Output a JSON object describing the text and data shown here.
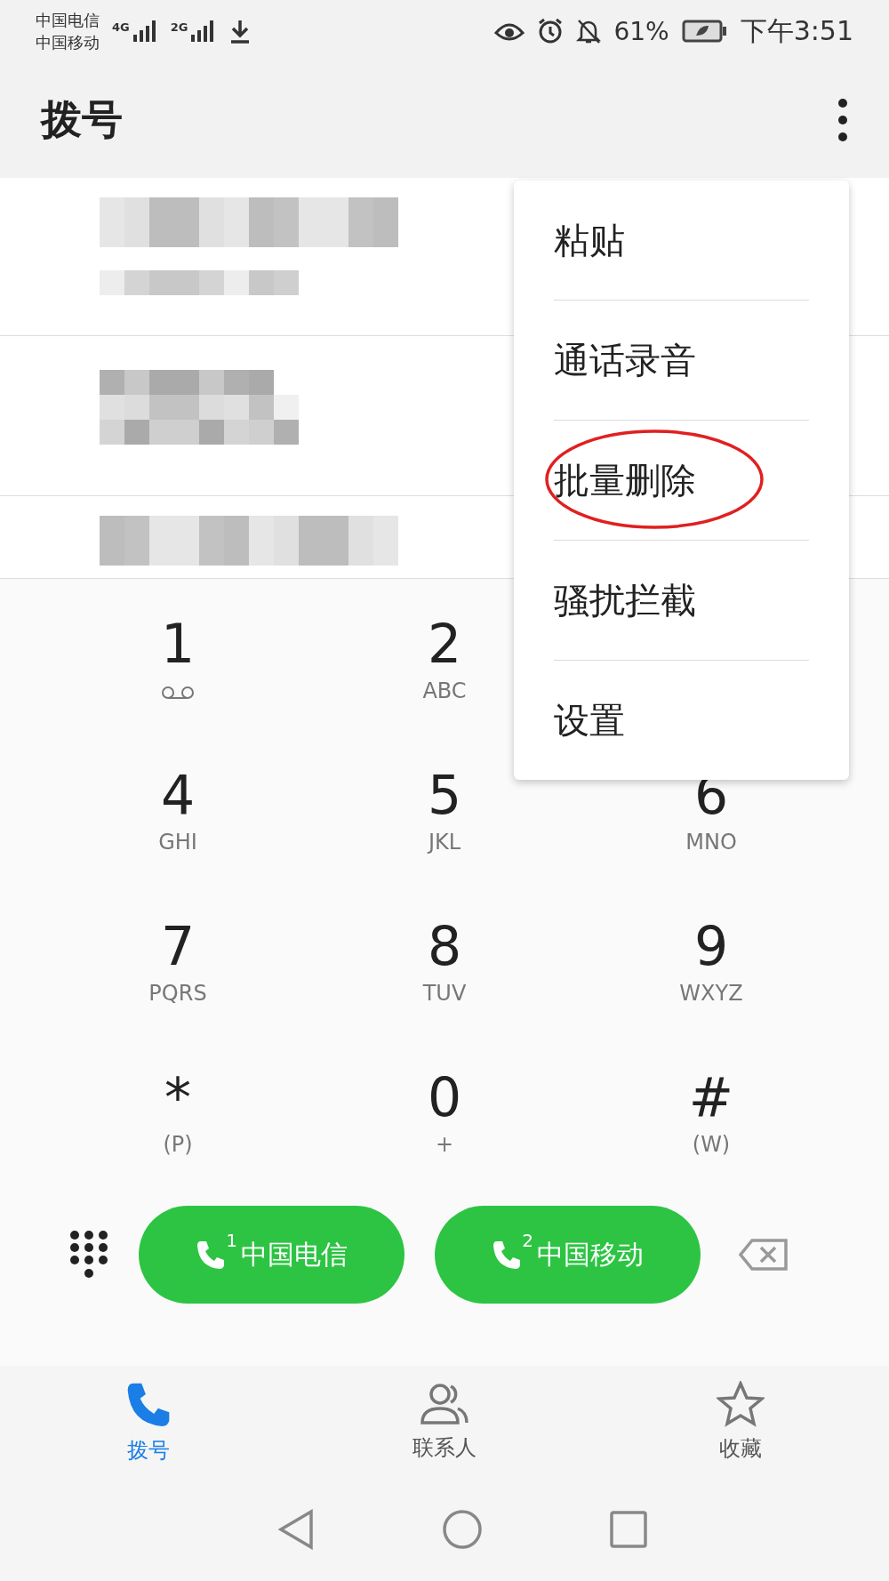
{
  "status_bar": {
    "carriers": [
      "中国电信",
      "中国移动"
    ],
    "networks": [
      "4G",
      "2G"
    ],
    "battery": "61%",
    "time": "下午3:51"
  },
  "header": {
    "title": "拨号"
  },
  "call_log": [
    {
      "kind": "redacted"
    },
    {
      "kind": "redacted"
    },
    {
      "kind": "redacted"
    }
  ],
  "menu": {
    "items": [
      {
        "label": "粘贴",
        "highlighted": false
      },
      {
        "label": "通话录音",
        "highlighted": false
      },
      {
        "label": "批量删除",
        "highlighted": true
      },
      {
        "label": "骚扰拦截",
        "highlighted": false
      },
      {
        "label": "设置",
        "highlighted": false
      }
    ]
  },
  "keypad": [
    [
      {
        "digit": "1",
        "kind": "voicemail"
      },
      {
        "digit": "2",
        "letters": "ABC",
        "kind": "letters"
      }
    ],
    [
      {
        "digit": "4",
        "letters": "GHI",
        "kind": "letters"
      },
      {
        "digit": "5",
        "letters": "JKL",
        "kind": "letters"
      },
      {
        "digit": "6",
        "letters": "MNO",
        "kind": "letters"
      }
    ],
    [
      {
        "digit": "7",
        "letters": "PQRS",
        "kind": "letters"
      },
      {
        "digit": "8",
        "letters": "TUV",
        "kind": "letters"
      },
      {
        "digit": "9",
        "letters": "WXYZ",
        "kind": "letters"
      }
    ],
    [
      {
        "digit": "*",
        "letters": "(P)",
        "kind": "letters"
      },
      {
        "digit": "0",
        "letters": "+",
        "kind": "letters"
      },
      {
        "digit": "#",
        "letters": "(W)",
        "kind": "letters"
      }
    ]
  ],
  "call_buttons": [
    {
      "sim": "1",
      "label": "中国电信"
    },
    {
      "sim": "2",
      "label": "中国移动"
    }
  ],
  "tabs": [
    {
      "label": "拨号",
      "kind": "phone",
      "selected": true
    },
    {
      "label": "联系人",
      "kind": "contacts",
      "selected": false
    },
    {
      "label": "收藏",
      "kind": "star",
      "selected": false
    }
  ]
}
